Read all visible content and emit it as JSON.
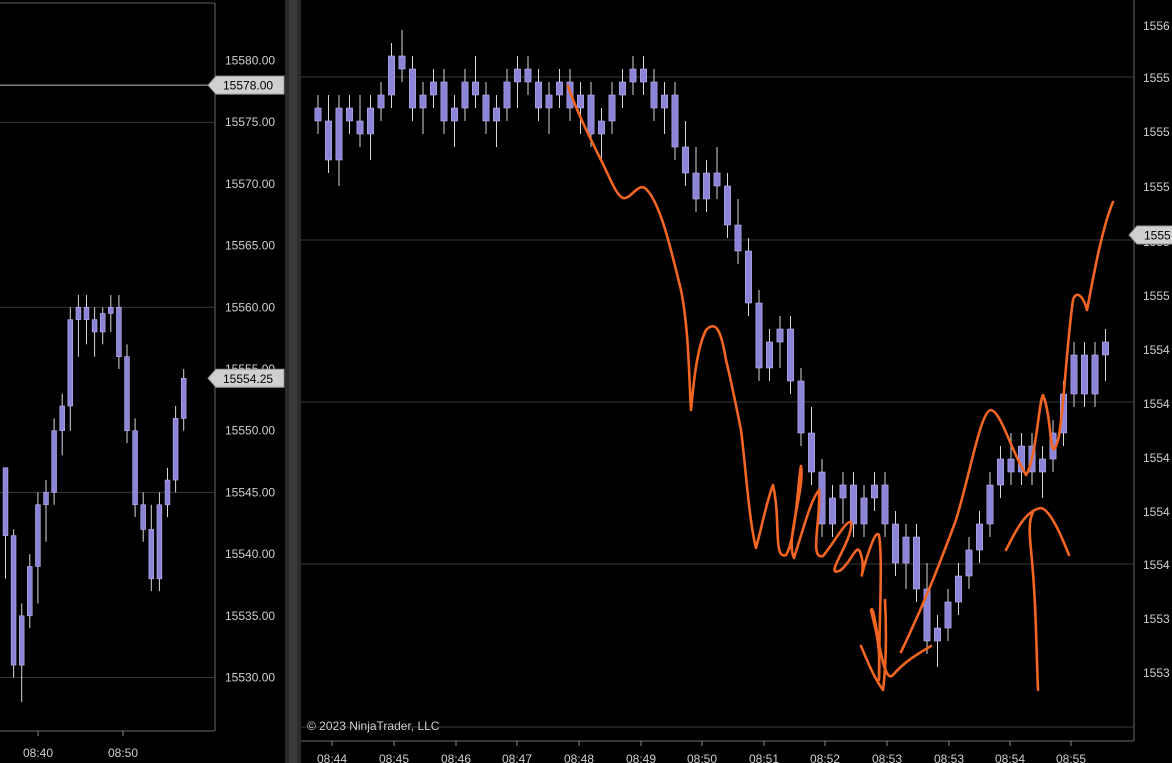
{
  "chart_data": [
    {
      "type": "candlestick",
      "panel": "left",
      "y_axis": {
        "ylim": [
          15525.0,
          15583.5
        ],
        "ticks": [
          "15580.00",
          "15575.00",
          "15570.00",
          "15565.00",
          "15560.00",
          "15555.00",
          "15550.00",
          "15545.00",
          "15540.00",
          "15535.00",
          "15530.00"
        ]
      },
      "x_axis": {
        "ticks": [
          "08:40",
          "08:50"
        ]
      },
      "markers": [
        {
          "label": "15578.00",
          "value": 15578.0
        },
        {
          "label": "15554.25",
          "value": 15554.25
        }
      ],
      "horizontal_lines": [
        15578.0
      ],
      "candles": [
        [
          15547,
          15547,
          15538,
          15541.5
        ],
        [
          15541.5,
          15542,
          15530,
          15531
        ],
        [
          15531,
          15536,
          15528,
          15535
        ],
        [
          15535,
          15540,
          15534,
          15539
        ],
        [
          15539,
          15545,
          15536,
          15544
        ],
        [
          15544,
          15546,
          15541,
          15545
        ],
        [
          15545,
          15551,
          15544,
          15550
        ],
        [
          15550,
          15553,
          15548,
          15552
        ],
        [
          15552,
          15560,
          15550,
          15559
        ],
        [
          15559,
          15561,
          15556,
          15560
        ],
        [
          15560,
          15561,
          15557,
          15559
        ],
        [
          15559,
          15560,
          15556,
          15558
        ],
        [
          15558,
          15560,
          15557,
          15559.5
        ],
        [
          15559.5,
          15561,
          15558,
          15560
        ],
        [
          15560,
          15561,
          15555,
          15556
        ],
        [
          15556,
          15557,
          15549,
          15550
        ],
        [
          15550,
          15551,
          15543,
          15544
        ],
        [
          15544,
          15545,
          15541,
          15542
        ],
        [
          15542,
          15544,
          15537,
          15538
        ],
        [
          15538,
          15545,
          15537,
          15544
        ],
        [
          15544,
          15547,
          15543,
          15546
        ],
        [
          15546,
          15552,
          15545,
          15551
        ],
        [
          15551,
          15555,
          15550,
          15554.25
        ]
      ]
    },
    {
      "type": "candlestick",
      "panel": "right",
      "y_axis": {
        "ticks": [
          "1556",
          "1555",
          "1555",
          "1555",
          "1555",
          "1555",
          "1554",
          "1554",
          "1554",
          "1554",
          "1554",
          "1553",
          "1553"
        ]
      },
      "x_axis": {
        "ticks": [
          "08:44",
          "08:45",
          "08:46",
          "08:47",
          "08:48",
          "08:49",
          "08:50",
          "08:51",
          "08:52",
          "08:53",
          "08:53",
          "08:54",
          "08:55"
        ]
      },
      "markers": [
        {
          "label": "1555",
          "value": 15555.4
        }
      ],
      "candles": [
        [
          15574,
          15575,
          15572,
          15573
        ],
        [
          15573,
          15575,
          15569,
          15570
        ],
        [
          15570,
          15575,
          15568,
          15574
        ],
        [
          15574,
          15575,
          15572,
          15573
        ],
        [
          15573,
          15575,
          15571,
          15572
        ],
        [
          15572,
          15575,
          15570,
          15574
        ],
        [
          15574,
          15576,
          15573,
          15575
        ],
        [
          15575,
          15579,
          15574,
          15578
        ],
        [
          15578,
          15580,
          15576,
          15577
        ],
        [
          15577,
          15578,
          15573,
          15574
        ],
        [
          15574,
          15576,
          15572,
          15575
        ],
        [
          15575,
          15577,
          15574,
          15576
        ],
        [
          15576,
          15577,
          15572,
          15573
        ],
        [
          15573,
          15575,
          15571,
          15574
        ],
        [
          15574,
          15577,
          15573,
          15576
        ],
        [
          15576,
          15578,
          15574,
          15575
        ],
        [
          15575,
          15576,
          15572,
          15573
        ],
        [
          15573,
          15575,
          15571,
          15574
        ],
        [
          15574,
          15577,
          15573,
          15576
        ],
        [
          15576,
          15578,
          15574,
          15577
        ],
        [
          15577,
          15578,
          15575,
          15576
        ],
        [
          15576,
          15577,
          15573,
          15574
        ],
        [
          15574,
          15576,
          15572,
          15575
        ],
        [
          15575,
          15577,
          15574,
          15576
        ],
        [
          15576,
          15577,
          15573,
          15574
        ],
        [
          15574,
          15576,
          15572,
          15575
        ],
        [
          15575,
          15576,
          15571,
          15572
        ],
        [
          15572,
          15574,
          15570,
          15573
        ],
        [
          15573,
          15576,
          15572,
          15575
        ],
        [
          15575,
          15577,
          15574,
          15576
        ],
        [
          15576,
          15578,
          15575,
          15577
        ],
        [
          15577,
          15578,
          15575,
          15576
        ],
        [
          15576,
          15577,
          15573,
          15574
        ],
        [
          15574,
          15576,
          15572,
          15575
        ],
        [
          15575,
          15576,
          15570,
          15571
        ],
        [
          15571,
          15573,
          15568,
          15569
        ],
        [
          15569,
          15571,
          15566,
          15567
        ],
        [
          15567,
          15570,
          15566,
          15569
        ],
        [
          15569,
          15571,
          15567,
          15568
        ],
        [
          15568,
          15569,
          15564,
          15565
        ],
        [
          15565,
          15567,
          15562,
          15563
        ],
        [
          15563,
          15564,
          15558,
          15559
        ],
        [
          15559,
          15560,
          15553,
          15554
        ],
        [
          15554,
          15557,
          15553,
          15556
        ],
        [
          15556,
          15558,
          15554,
          15557
        ],
        [
          15557,
          15558,
          15552,
          15553
        ],
        [
          15553,
          15554,
          15548,
          15549
        ],
        [
          15549,
          15551,
          15545,
          15546
        ],
        [
          15546,
          15547,
          15541,
          15542
        ],
        [
          15542,
          15545,
          15541,
          15544
        ],
        [
          15544,
          15546,
          15542,
          15545
        ],
        [
          15545,
          15546,
          15541,
          15542
        ],
        [
          15542,
          15545,
          15541,
          15544
        ],
        [
          15544,
          15546,
          15543,
          15545
        ],
        [
          15545,
          15546,
          15541,
          15542
        ],
        [
          15542,
          15543,
          15538,
          15539
        ],
        [
          15539,
          15542,
          15537,
          15541
        ],
        [
          15541,
          15542,
          15536,
          15537
        ],
        [
          15537,
          15539,
          15532,
          15533
        ],
        [
          15533,
          15535,
          15531,
          15534
        ],
        [
          15534,
          15537,
          15533,
          15536
        ],
        [
          15536,
          15539,
          15535,
          15538
        ],
        [
          15538,
          15541,
          15537,
          15540
        ],
        [
          15540,
          15543,
          15539,
          15542
        ],
        [
          15542,
          15546,
          15541,
          15545
        ],
        [
          15545,
          15548,
          15544,
          15547
        ],
        [
          15547,
          15549,
          15545,
          15546
        ],
        [
          15546,
          15549,
          15545,
          15548
        ],
        [
          15548,
          15549,
          15545,
          15546
        ],
        [
          15546,
          15548,
          15544,
          15547
        ],
        [
          15547,
          15550,
          15546,
          15549
        ],
        [
          15549,
          15553,
          15548,
          15552
        ],
        [
          15552,
          15556,
          15551,
          15555
        ],
        [
          15555,
          15556,
          15551,
          15552
        ],
        [
          15552,
          15556,
          15551,
          15555
        ],
        [
          15555,
          15557,
          15553,
          15556
        ]
      ]
    }
  ],
  "left_axis": {
    "tick_labels": [
      "15580.00",
      "15575.00",
      "15570.00",
      "15565.00",
      "15560.00",
      "15555.00",
      "15550.00",
      "15545.00",
      "15540.00",
      "15535.00",
      "15530.00"
    ],
    "x_labels": [
      "08:40",
      "08:50"
    ],
    "price_tags": [
      "15578.00",
      "15554.25"
    ]
  },
  "right_axis": {
    "tick_labels": [
      "1556",
      "1555",
      "1555",
      "1555",
      "1555",
      "1555",
      "1554",
      "1554",
      "1554",
      "1554",
      "1554",
      "1553",
      "1553"
    ],
    "x_labels": [
      "08:44",
      "08:45",
      "08:46",
      "08:47",
      "08:48",
      "08:49",
      "08:50",
      "08:51",
      "08:52",
      "08:53",
      "08:53",
      "08:54",
      "08:55"
    ],
    "price_tag": "1555"
  },
  "copyright": "© 2023 NinjaTrader, LLC",
  "colors": {
    "background": "#000000",
    "candle": "#8c84d6",
    "candle_border": "#b9b3ee",
    "wick": "#d8d8d8",
    "gridline": "#3a3a3a",
    "drawing": "#f26522",
    "price_tag_bg": "#d0d0d0",
    "price_tag_text": "#000000"
  }
}
